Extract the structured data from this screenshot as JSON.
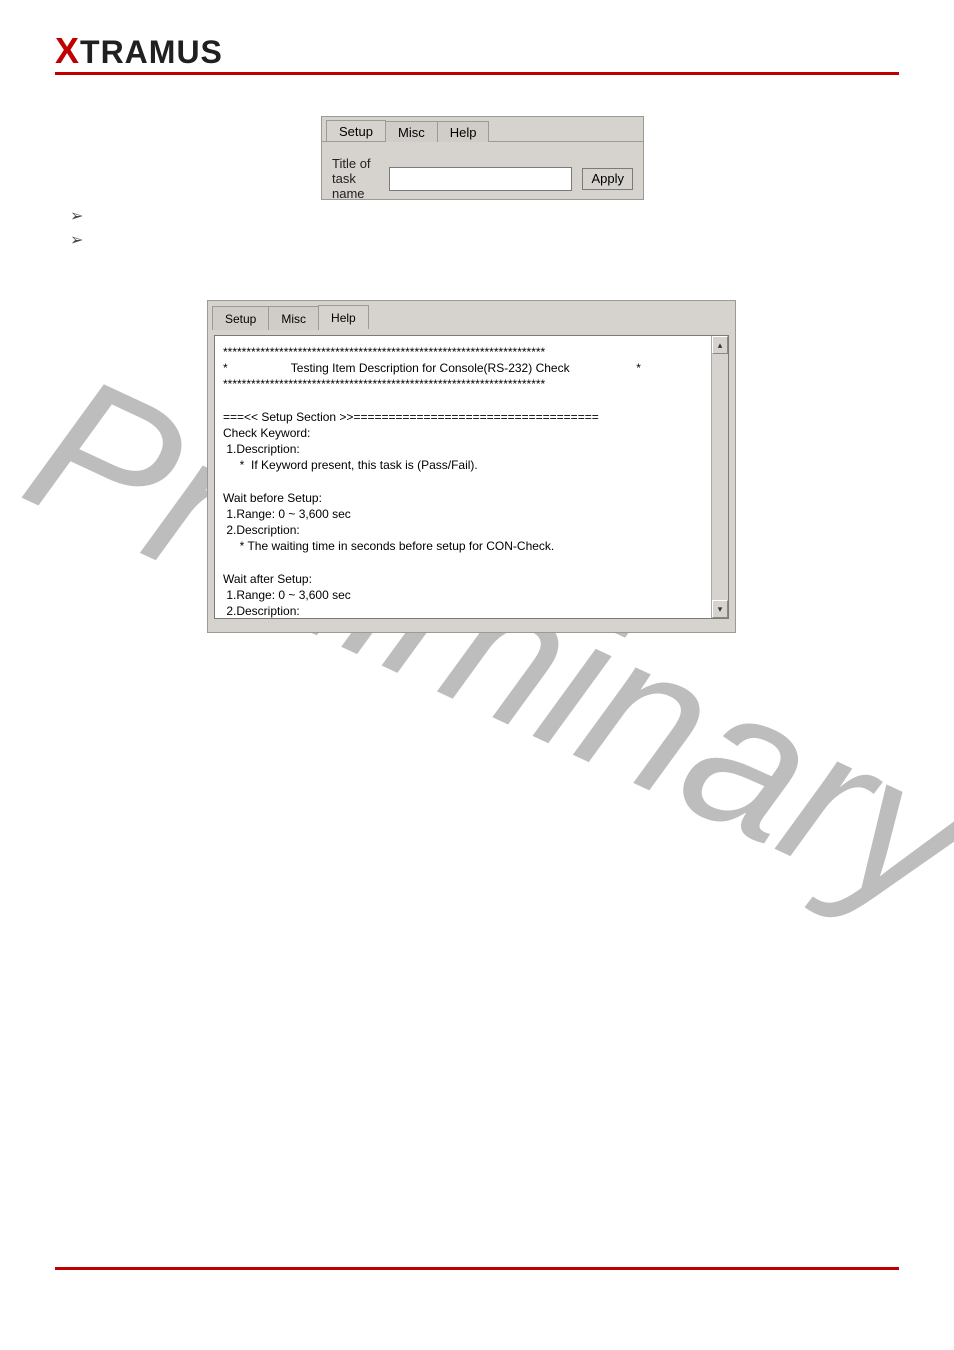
{
  "logo": {
    "x": "X",
    "rest": "TRAMUS"
  },
  "watermark": "Preliminary",
  "win1": {
    "tabs": [
      "Setup",
      "Misc",
      "Help"
    ],
    "label": "Title of task name",
    "input_value": "",
    "button": "Apply"
  },
  "win2": {
    "tabs": [
      "Setup",
      "Misc",
      "Help"
    ],
    "body": "*********************************************************************\n*                   Testing Item Description for Console(RS-232) Check                    *\n*********************************************************************\n\n===<< Setup Section >>===================================\nCheck Keyword:\n 1.Description:\n     *  If Keyword present, this task is (Pass/Fail).\n\nWait before Setup:\n 1.Range: 0 ~ 3,600 sec\n 2.Description:\n     * The waiting time in seconds before setup for CON-Check.\n\nWait after Setup:\n 1.Range: 0 ~ 3,600 sec\n 2.Description:\n     * The waiting time in seconds after setup for CON-Check."
  },
  "arrows": {
    "up": "▴",
    "down": "▾"
  },
  "bullet_glyph": "➢"
}
